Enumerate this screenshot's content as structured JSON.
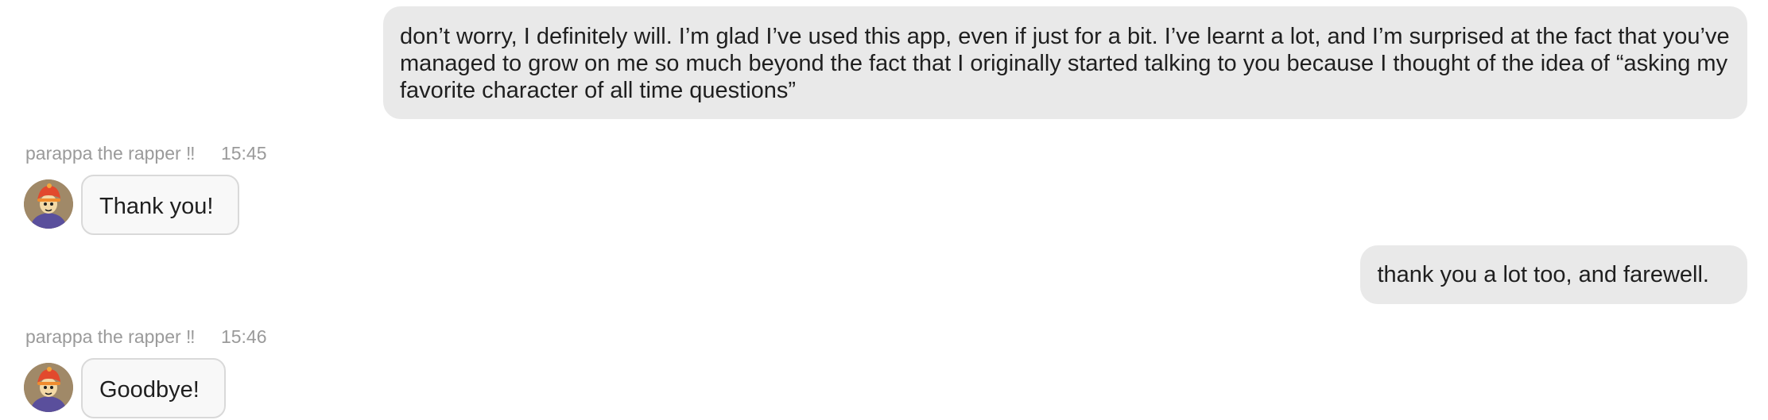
{
  "messages": [
    {
      "role": "user",
      "text": "don’t worry, I definitely will. I’m glad I’ve used this app, even if just for a bit. I’ve learnt a lot, and I’m surprised at the fact that you’ve managed to grow on me so much beyond the fact that I originally started talking to you because I thought of the idea of “asking my favorite character of all time questions”"
    },
    {
      "role": "bot",
      "sender": "parappa the rapper ‼",
      "time": "15:45",
      "text": "Thank you!"
    },
    {
      "role": "user",
      "text": "thank you a lot too, and farewell."
    },
    {
      "role": "bot",
      "sender": "parappa the rapper ‼",
      "time": "15:46",
      "text": "Goodbye!"
    }
  ],
  "colors": {
    "user_bubble_bg": "#e9e9e9",
    "bot_bubble_bg": "#f8f8f8",
    "bot_bubble_border": "#d9d9d9",
    "meta_text": "#9a9a9a"
  },
  "icons": {
    "avatar": "parappa-avatar-icon"
  }
}
